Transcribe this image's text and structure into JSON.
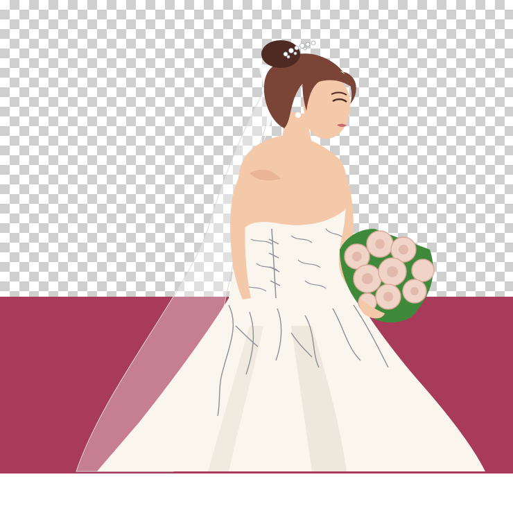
{
  "image": {
    "subject": "illustrated-bride",
    "colors": {
      "checker_light": "#ffffff",
      "checker_dark": "#cfcfcf",
      "band": "#a83a5a",
      "skin": "#f4c9aa",
      "skin_shadow": "#e3a98a",
      "hair": "#7a4536",
      "hair_dark": "#4e2a22",
      "dress": "#faf6ee",
      "dress_shadow": "#e6ddd0",
      "lace": "#8a8f98",
      "veil": "#ffffff",
      "rose": "#f1d4c8",
      "rose_dark": "#d9a99a",
      "leaf": "#3f8a3a"
    }
  }
}
